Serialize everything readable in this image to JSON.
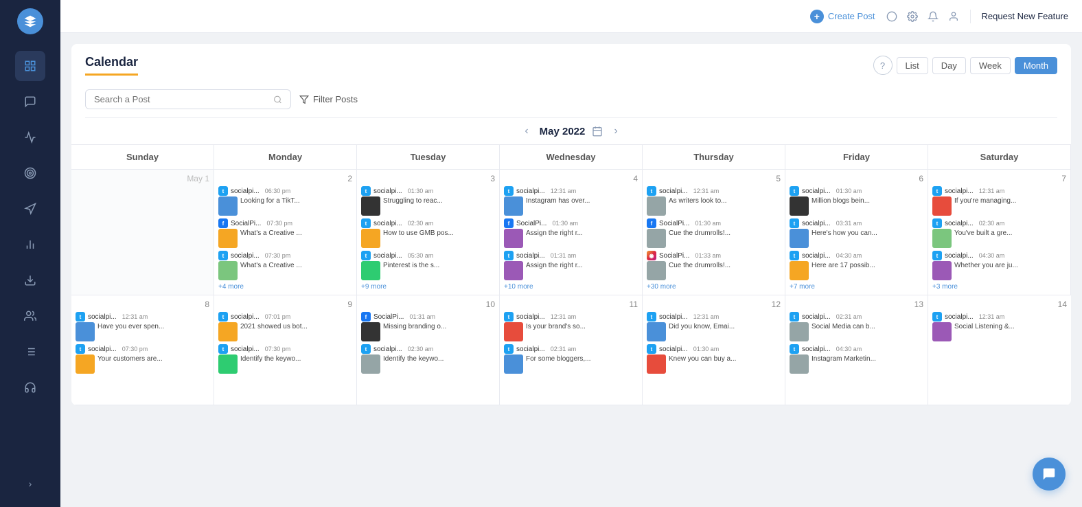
{
  "sidebar": {
    "logo_label": "SendPulse",
    "items": [
      {
        "id": "dashboard",
        "icon": "⊞",
        "label": "Dashboard"
      },
      {
        "id": "inbox",
        "icon": "💬",
        "label": "Inbox",
        "active": true
      },
      {
        "id": "analytics",
        "icon": "📊",
        "label": "Analytics"
      },
      {
        "id": "target",
        "icon": "◎",
        "label": "Target"
      },
      {
        "id": "campaigns",
        "icon": "📢",
        "label": "Campaigns"
      },
      {
        "id": "reports",
        "icon": "📈",
        "label": "Reports"
      },
      {
        "id": "download",
        "icon": "⬇",
        "label": "Download"
      },
      {
        "id": "team",
        "icon": "👥",
        "label": "Team"
      },
      {
        "id": "list",
        "icon": "☰",
        "label": "List"
      },
      {
        "id": "support",
        "icon": "🎧",
        "label": "Support"
      }
    ],
    "expand_label": ">"
  },
  "topbar": {
    "create_post_label": "Create Post",
    "request_feature_label": "Request New Feature"
  },
  "calendar": {
    "title": "Calendar",
    "help_label": "?",
    "view_buttons": [
      "List",
      "Day",
      "Week",
      "Month"
    ],
    "active_view": "Month",
    "nav_month": "May 2022",
    "search_placeholder": "Search a Post",
    "filter_label": "Filter Posts",
    "day_headers": [
      "Sunday",
      "Monday",
      "Tuesday",
      "Wednesday",
      "Thursday",
      "Friday",
      "Saturday"
    ]
  },
  "week1": {
    "days": [
      {
        "num": "May 1",
        "inactive": true,
        "posts": []
      },
      {
        "num": "2",
        "posts": [
          {
            "platform": "tw",
            "name": "socialpi...",
            "time": "06:30 pm",
            "thumb": "blue",
            "text": "Looking for a TikT..."
          },
          {
            "platform": "fb",
            "name": "SocialPi...",
            "time": "07:30 pm",
            "thumb": "orange",
            "text": "What's a Creative ..."
          },
          {
            "platform": "tw",
            "name": "socialpi...",
            "time": "07:30 pm",
            "thumb": "green",
            "text": "What's a Creative ..."
          }
        ],
        "more": "+4 more"
      },
      {
        "num": "3",
        "posts": [
          {
            "platform": "tw",
            "name": "socialpi...",
            "time": "01:30 am",
            "thumb": "dark",
            "text": "Struggling to reac..."
          },
          {
            "platform": "tw",
            "name": "socialpi...",
            "time": "02:30 am",
            "thumb": "orange",
            "text": "How to use GMB pos..."
          },
          {
            "platform": "tw",
            "name": "socialpi...",
            "time": "05:30 am",
            "thumb": "teal",
            "text": "Pinterest is the s..."
          }
        ],
        "more": "+9 more"
      },
      {
        "num": "4",
        "posts": [
          {
            "platform": "tw",
            "name": "socialpi...",
            "time": "12:31 am",
            "thumb": "blue",
            "text": "Instagram has over..."
          },
          {
            "platform": "fb",
            "name": "SocialPi...",
            "time": "01:30 am",
            "thumb": "purple",
            "text": "Assign the right r..."
          },
          {
            "platform": "tw",
            "name": "socialpi...",
            "time": "01:31 am",
            "thumb": "purple",
            "text": "Assign the right r..."
          }
        ],
        "more": "+10 more"
      },
      {
        "num": "5",
        "posts": [
          {
            "platform": "tw",
            "name": "socialpi...",
            "time": "12:31 am",
            "thumb": "gray",
            "text": "As writers look to..."
          },
          {
            "platform": "fb",
            "name": "SocialPi...",
            "time": "01:30 am",
            "thumb": "gray",
            "text": "Cue the drumrolls!..."
          },
          {
            "platform": "ig",
            "name": "SocialPi...",
            "time": "01:33 am",
            "thumb": "gray",
            "text": "Cue the drumrolls!..."
          }
        ],
        "more": "+30 more"
      },
      {
        "num": "6",
        "posts": [
          {
            "platform": "tw",
            "name": "socialpi...",
            "time": "01:30 am",
            "thumb": "dark",
            "text": "Million blogs bein..."
          },
          {
            "platform": "tw",
            "name": "socialpi...",
            "time": "03:31 am",
            "thumb": "blue",
            "text": "Here's how you can..."
          },
          {
            "platform": "tw",
            "name": "socialpi...",
            "time": "04:30 am",
            "thumb": "orange",
            "text": "Here are 17 possib..."
          }
        ],
        "more": "+7 more"
      },
      {
        "num": "7",
        "posts": [
          {
            "platform": "tw",
            "name": "socialpi...",
            "time": "12:31 am",
            "thumb": "red",
            "text": "If you're managing..."
          },
          {
            "platform": "tw",
            "name": "socialpi...",
            "time": "02:30 am",
            "thumb": "green",
            "text": "You've built a gre..."
          },
          {
            "platform": "tw",
            "name": "socialpi...",
            "time": "04:30 am",
            "thumb": "purple",
            "text": "Whether you are ju..."
          }
        ],
        "more": "+3 more"
      }
    ]
  },
  "week2": {
    "days": [
      {
        "num": "8",
        "posts": [
          {
            "platform": "tw",
            "name": "socialpi...",
            "time": "12:31 am",
            "thumb": "blue",
            "text": "Have you ever spen..."
          },
          {
            "platform": "tw",
            "name": "socialpi...",
            "time": "07:30 pm",
            "thumb": "orange",
            "text": "Your customers are..."
          }
        ],
        "more": ""
      },
      {
        "num": "9",
        "posts": [
          {
            "platform": "tw",
            "name": "socialpi...",
            "time": "07:01 pm",
            "thumb": "orange",
            "text": "2021 showed us bot..."
          },
          {
            "platform": "tw",
            "name": "socialpi...",
            "time": "07:30 pm",
            "thumb": "teal",
            "text": "Identify the keywo..."
          }
        ],
        "more": ""
      },
      {
        "num": "10",
        "posts": [
          {
            "platform": "fb",
            "name": "SocialPi...",
            "time": "01:31 am",
            "thumb": "dark",
            "text": "Missing branding o..."
          },
          {
            "platform": "tw",
            "name": "socialpi...",
            "time": "02:30 am",
            "thumb": "gray",
            "text": "Identify the keywo..."
          }
        ],
        "more": ""
      },
      {
        "num": "11",
        "posts": [
          {
            "platform": "tw",
            "name": "socialpi...",
            "time": "12:31 am",
            "thumb": "red",
            "text": "Is your brand's so..."
          },
          {
            "platform": "tw",
            "name": "socialpi...",
            "time": "02:31 am",
            "thumb": "blue",
            "text": "For some bloggers,..."
          }
        ],
        "more": ""
      },
      {
        "num": "12",
        "posts": [
          {
            "platform": "tw",
            "name": "socialpi...",
            "time": "12:31 am",
            "thumb": "blue",
            "text": "Did you know, Emai..."
          },
          {
            "platform": "tw",
            "name": "socialpi...",
            "time": "01:30 am",
            "thumb": "red",
            "text": "Knew you can buy a..."
          }
        ],
        "more": ""
      },
      {
        "num": "13",
        "posts": [
          {
            "platform": "tw",
            "name": "socialpi...",
            "time": "02:31 am",
            "thumb": "gray",
            "text": "Social Media can b..."
          },
          {
            "platform": "tw",
            "name": "socialpi...",
            "time": "04:30 am",
            "thumb": "gray",
            "text": "Instagram Marketin..."
          }
        ],
        "more": ""
      },
      {
        "num": "14",
        "posts": [
          {
            "platform": "tw",
            "name": "socialpi...",
            "time": "12:31 am",
            "thumb": "purple",
            "text": "Social Listening &..."
          }
        ],
        "more": ""
      }
    ]
  }
}
